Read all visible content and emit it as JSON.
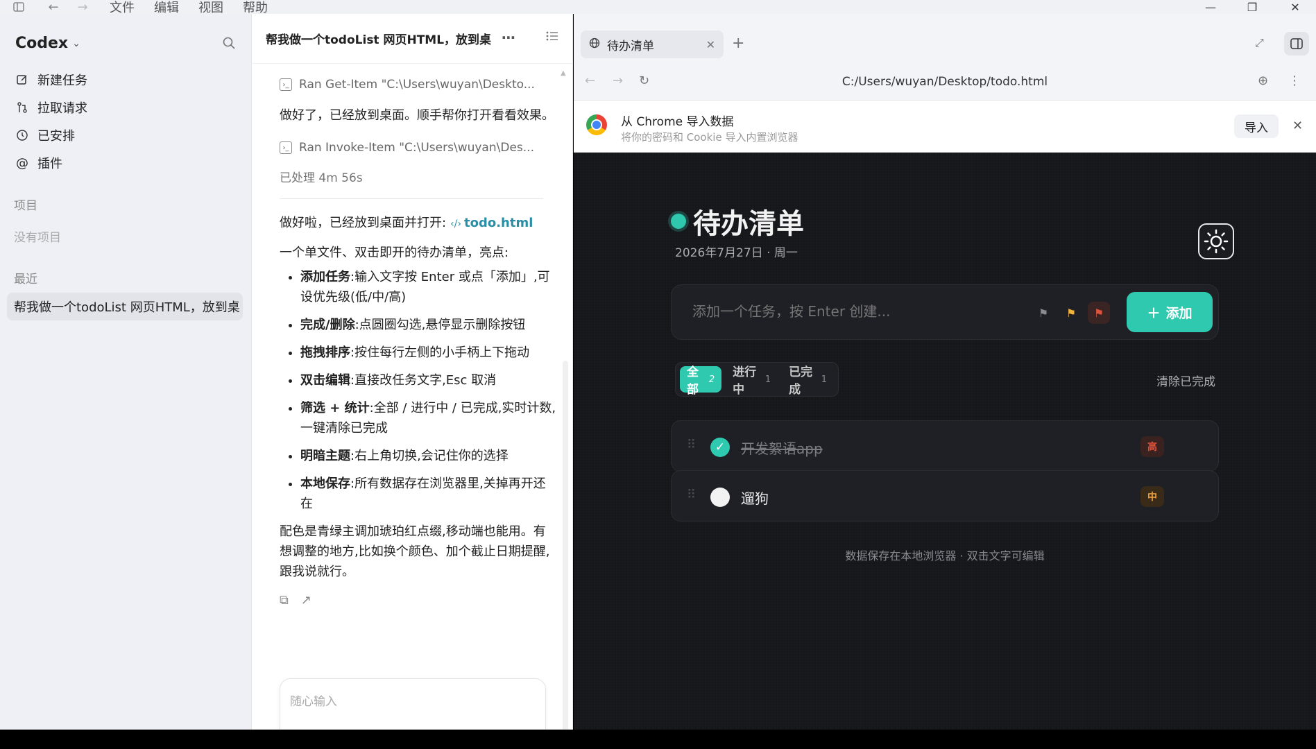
{
  "menubar": {
    "items": [
      "文件",
      "编辑",
      "视图",
      "帮助"
    ]
  },
  "sidebar": {
    "brand": "Codex",
    "nav": [
      {
        "label": "新建任务",
        "icon": "edit-icon"
      },
      {
        "label": "拉取请求",
        "icon": "pull-request-icon"
      },
      {
        "label": "已安排",
        "icon": "clock-icon"
      },
      {
        "label": "插件",
        "icon": "at-icon"
      }
    ],
    "projects_label": "项目",
    "no_projects": "没有项目",
    "recent_label": "最近",
    "recent_items": [
      "帮我做一个todoList 网页HTML，放到桌"
    ]
  },
  "chat": {
    "title": "帮我做一个todoList 网页HTML，放到桌",
    "cmd1": "Ran Get-Item \"C:\\Users\\wuyan\\Deskto...",
    "para1": "做好了，已经放到桌面。顺手帮你打开看看效果。",
    "cmd2": "Ran Invoke-Item \"C:\\Users\\wuyan\\Des...",
    "processed": "已处理 4m 56s",
    "opened_prefix": "做好啦，已经放到桌面并打开:",
    "file_link": "todo.html",
    "intro": "一个单文件、双击即开的待办清单，亮点:",
    "features": [
      {
        "title": "添加任务",
        "desc": ":输入文字按 Enter 或点「添加」,可设优先级(低/中/高)"
      },
      {
        "title": "完成/删除",
        "desc": ":点圆圈勾选,悬停显示删除按钮"
      },
      {
        "title": "拖拽排序",
        "desc": ":按住每行左侧的小手柄上下拖动"
      },
      {
        "title": "双击编辑",
        "desc": ":直接改任务文字,Esc 取消"
      },
      {
        "title": "筛选 + 统计",
        "desc": ":全部 / 进行中 / 已完成,实时计数,一键清除已完成"
      },
      {
        "title": "明暗主题",
        "desc": ":右上角切换,会记住你的选择"
      },
      {
        "title": "本地保存",
        "desc": ":所有数据存在浏览器里,关掉再开还在"
      }
    ],
    "closing": "配色是青绿主调加琥珀红点缀,移动端也能用。有想调整的地方,比如换个颜色、加个截止日期提醒,跟我说就行。",
    "input_placeholder": "随心输入"
  },
  "browser": {
    "tab_title": "待办清单",
    "url": "C:/Users/wuyan/Desktop/todo.html",
    "import_title": "从 Chrome 导入数据",
    "import_sub": "将你的密码和 Cookie 导入内置浏览器",
    "import_button": "导入"
  },
  "todo": {
    "title": "待办清单",
    "date": "2026年7月27日 · 周一",
    "input_placeholder": "添加一个任务，按 Enter 创建...",
    "add_label": "添加",
    "filters": [
      {
        "label": "全部",
        "count": "2",
        "active": true
      },
      {
        "label": "进行中",
        "count": "1",
        "active": false
      },
      {
        "label": "已完成",
        "count": "1",
        "active": false
      }
    ],
    "clear_done": "清除已完成",
    "items": [
      {
        "text": "开发絮语app",
        "done": true,
        "priority": "高",
        "priority_color": "#e0533d"
      },
      {
        "text": "遛狗",
        "done": false,
        "priority": "中",
        "priority_color": "#f2a23a"
      }
    ],
    "footer": "数据保存在本地浏览器 · 双击文字可编辑",
    "colors": {
      "accent": "#2ec9ae",
      "background": "#16171b",
      "flag_low": "#8a8b92",
      "flag_mid": "#f2b33a",
      "flag_high": "#e0533d"
    }
  }
}
